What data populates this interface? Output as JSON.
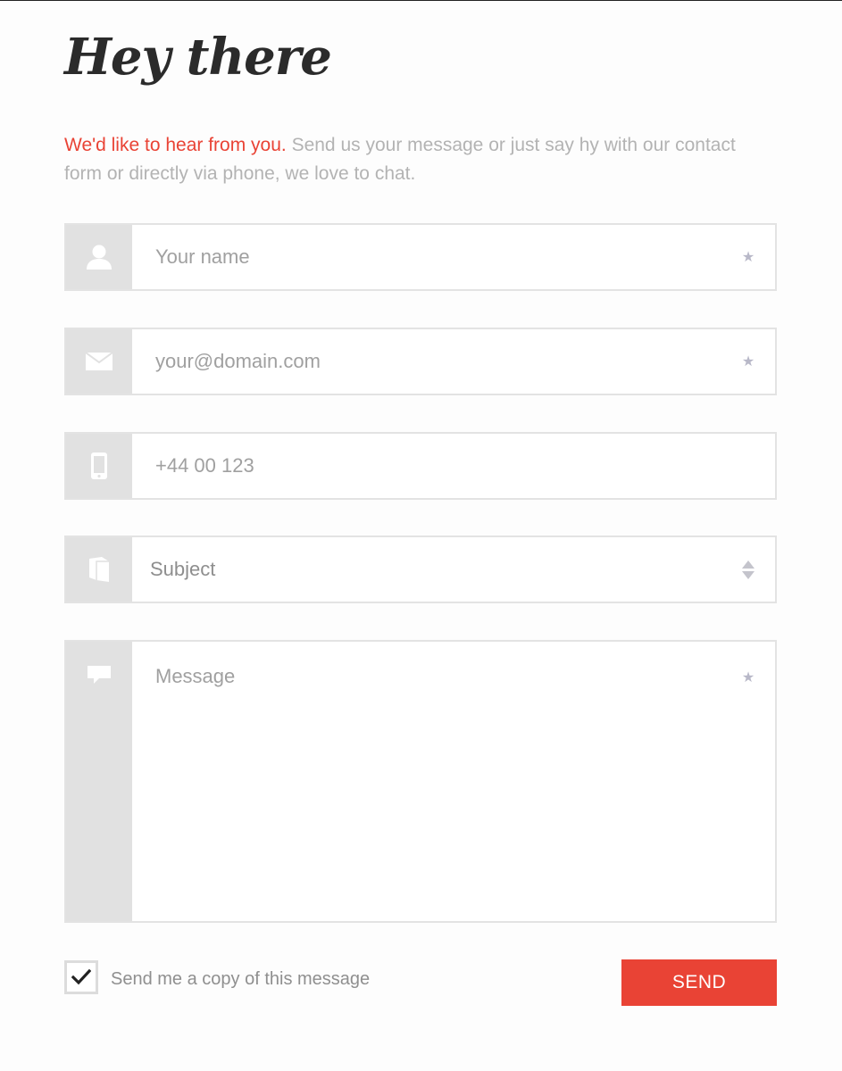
{
  "title": "Hey there",
  "intro": {
    "accent": "We'd like to hear from you.",
    "text": " Send us your message or just say hy with our contact form or directly via phone, we love to chat."
  },
  "form": {
    "name": {
      "placeholder": "Your name",
      "required_mark": "★",
      "icon": "user-icon"
    },
    "email": {
      "placeholder": "your@domain.com",
      "required_mark": "★",
      "icon": "envelope-icon"
    },
    "phone": {
      "placeholder": "+44 00 123",
      "icon": "mobile-phone-icon"
    },
    "subject": {
      "value": "Subject",
      "icon": "book-icon"
    },
    "message": {
      "placeholder": "Message",
      "required_mark": "★",
      "icon": "speech-bubble-icon"
    }
  },
  "copy_checkbox": {
    "label": "Send me a copy of this message",
    "checked": true
  },
  "send_button": {
    "label": "SEND"
  },
  "colors": {
    "accent": "#e94335",
    "icon_bg": "#e1e1e1",
    "border": "#e3e3e3"
  }
}
